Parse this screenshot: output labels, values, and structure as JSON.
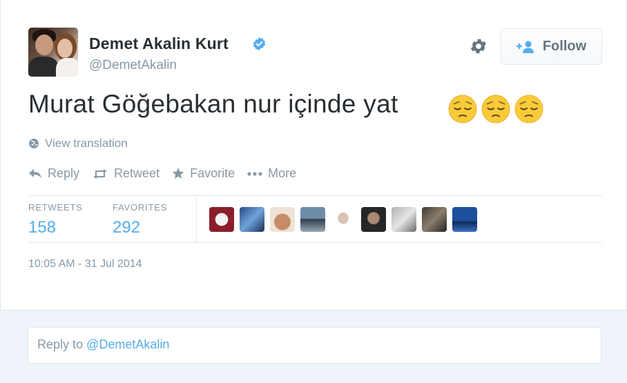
{
  "user": {
    "name": "Demet Akalin Kurt",
    "handle": "@DemetAkalin",
    "verified": true
  },
  "header": {
    "follow_label": "Follow"
  },
  "tweet": {
    "text": "Murat Göğebakan nur içinde yat",
    "emojis": [
      "pensive-face-emoji",
      "pensive-face-emoji",
      "pensive-face-emoji"
    ],
    "translation_label": "View translation"
  },
  "actions": {
    "reply": "Reply",
    "retweet": "Retweet",
    "favorite": "Favorite",
    "more": "More"
  },
  "stats": {
    "retweets_label": "RETWEETS",
    "retweets_count": "158",
    "favorites_label": "FAVORITES",
    "favorites_count": "292"
  },
  "timestamp": "10:05 AM - 31 Jul 2014",
  "reply": {
    "prefix": "Reply to ",
    "mention": "@DemetAkalin"
  },
  "colors": {
    "link": "#55acee",
    "muted": "#8899a6",
    "text": "#292f33",
    "reply_bg": "#eef4f9"
  }
}
